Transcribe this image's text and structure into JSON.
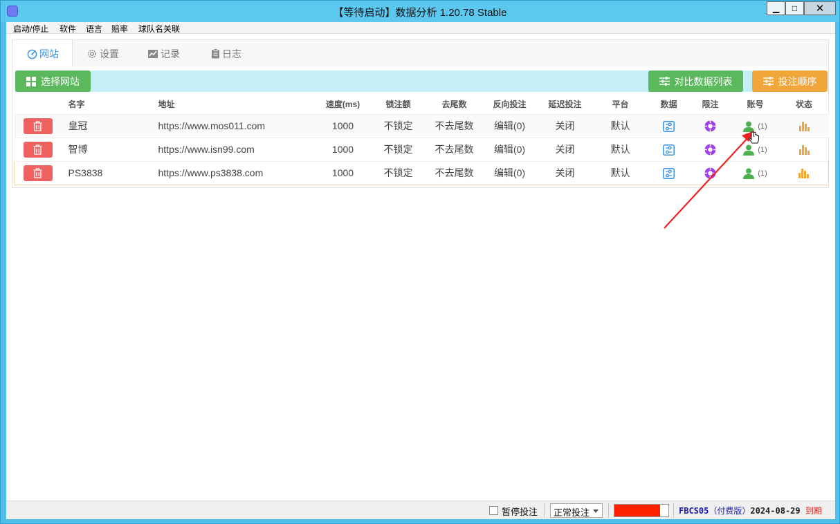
{
  "window": {
    "title": "【等待启动】数据分析 1.20.78 Stable",
    "min_label": "▁",
    "max_label": "□",
    "close_label": "✕"
  },
  "menu": [
    "启动/停止",
    "软件",
    "语言",
    "赔率",
    "球队名关联"
  ],
  "tabs": [
    {
      "label": "网站",
      "icon": "gauge-icon",
      "active": true
    },
    {
      "label": "设置",
      "icon": "gear-icon",
      "active": false
    },
    {
      "label": "记录",
      "icon": "chart-icon",
      "active": false
    },
    {
      "label": "日志",
      "icon": "clipboard-icon",
      "active": false
    }
  ],
  "toolbar": {
    "select_site_label": "选择网站",
    "compare_list_label": "对比数据列表",
    "bet_order_label": "投注顺序"
  },
  "table": {
    "headers": {
      "name": "名字",
      "url": "地址",
      "speed": "速度(ms)",
      "lock": "锁注额",
      "tail": "去尾数",
      "reverse": "反向投注",
      "delay": "延迟投注",
      "platform": "平台",
      "data": "数据",
      "limit": "限注",
      "account": "账号",
      "status": "状态"
    },
    "rows": [
      {
        "name": "皇冠",
        "url": "https://www.mos011.com",
        "speed": "1000",
        "lock": "不锁定",
        "tail": "不去尾数",
        "reverse": "编辑(0)",
        "delay": "关闭",
        "platform": "默认",
        "account_count": "(1)"
      },
      {
        "name": "智博",
        "url": "https://www.isn99.com",
        "speed": "1000",
        "lock": "不锁定",
        "tail": "不去尾数",
        "reverse": "编辑(0)",
        "delay": "关闭",
        "platform": "默认",
        "account_count": "(1)"
      },
      {
        "name": "PS3838",
        "url": "https://www.ps3838.com",
        "speed": "1000",
        "lock": "不锁定",
        "tail": "不去尾数",
        "reverse": "编辑(0)",
        "delay": "关闭",
        "platform": "默认",
        "account_count": "(1)"
      }
    ]
  },
  "statusbar": {
    "pause_label": "暂停投注",
    "mode_value": "正常投注",
    "progress": 0.85,
    "license_code": "FBCS05",
    "edition": "（付费版）",
    "expiry_date": "2024-08-29",
    "expiry_label": "到期"
  },
  "colors": {
    "accent_blue": "#3a93e8",
    "green": "#5cb85c",
    "orange": "#f0a63b",
    "delete_red": "#f06262",
    "progress_red": "#ff2000"
  }
}
